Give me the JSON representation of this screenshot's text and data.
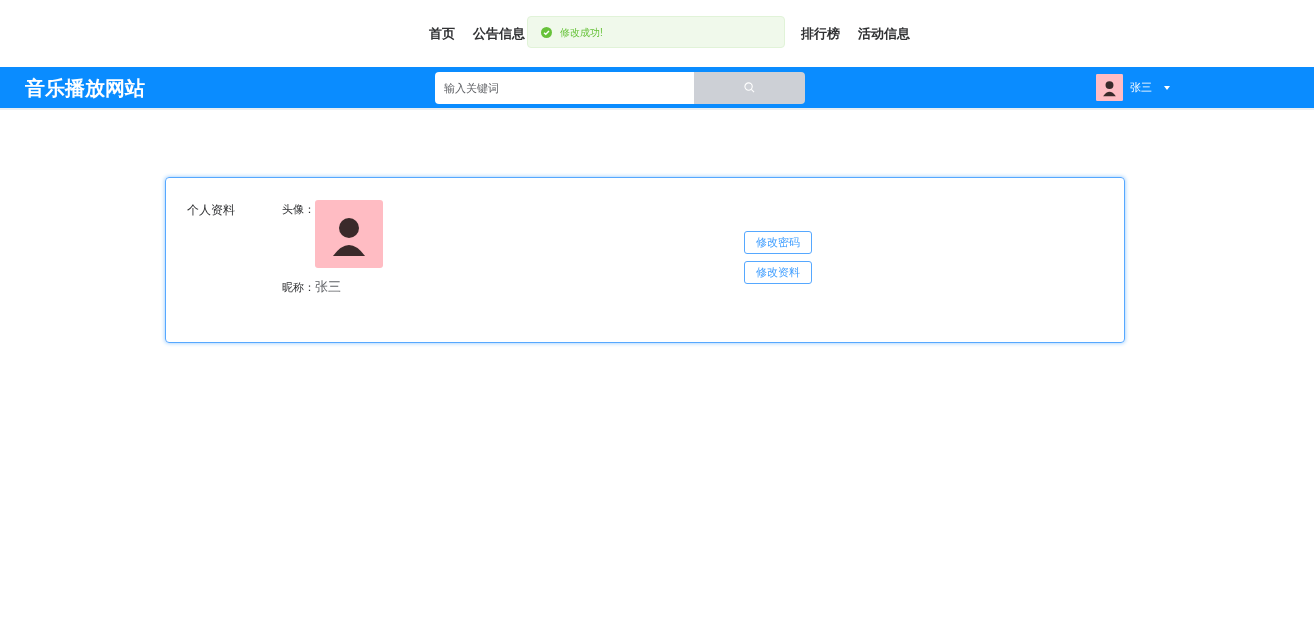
{
  "nav": {
    "items_before": [
      "首页",
      "公告信息"
    ],
    "items_after": [
      "排行榜",
      "活动信息"
    ]
  },
  "toast": {
    "message": "修改成功!"
  },
  "header": {
    "title": "音乐播放网站",
    "search": {
      "placeholder": "输入关键词"
    },
    "user": {
      "name": "张三"
    }
  },
  "profile": {
    "section_title": "个人资料",
    "avatar_label": "头像：",
    "nickname_label": "昵称：",
    "nickname": "张三",
    "buttons": [
      "修改密码",
      "修改资料"
    ]
  }
}
